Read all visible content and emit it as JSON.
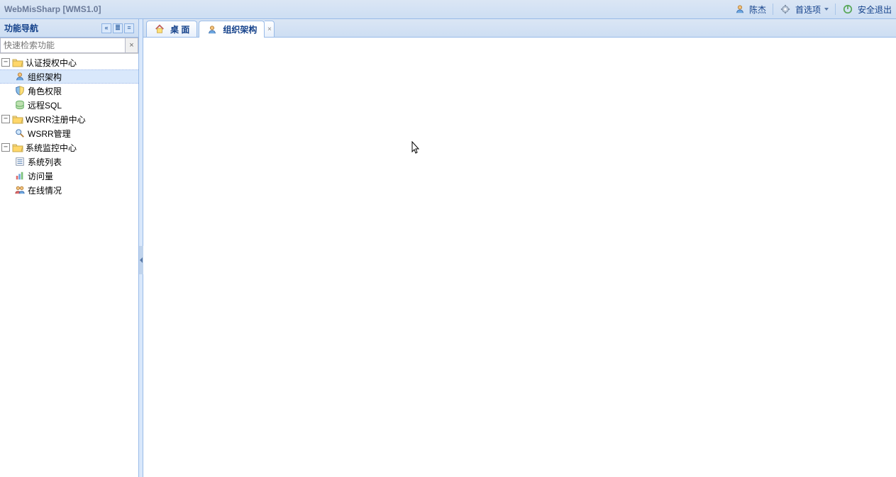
{
  "app": {
    "title": "WebMisSharp [WMS1.0]"
  },
  "topbar": {
    "user": "陈杰",
    "prefs": "首选项",
    "logout": "安全退出"
  },
  "sidebar": {
    "title": "功能导航",
    "search_placeholder": "快速检索功能",
    "tree": [
      {
        "label": "认证授权中心",
        "children": [
          {
            "label": "组织架构",
            "selected": true
          },
          {
            "label": "角色权限"
          },
          {
            "label": "远程SQL"
          }
        ]
      },
      {
        "label": "WSRR注册中心",
        "children": [
          {
            "label": "WSRR管理"
          }
        ]
      },
      {
        "label": "系统监控中心",
        "children": [
          {
            "label": "系统列表"
          },
          {
            "label": "访问量"
          },
          {
            "label": "在线情况"
          }
        ]
      }
    ]
  },
  "tabs": [
    {
      "label": "桌 面",
      "closable": false
    },
    {
      "label": "组织架构",
      "closable": true,
      "active": true
    }
  ]
}
